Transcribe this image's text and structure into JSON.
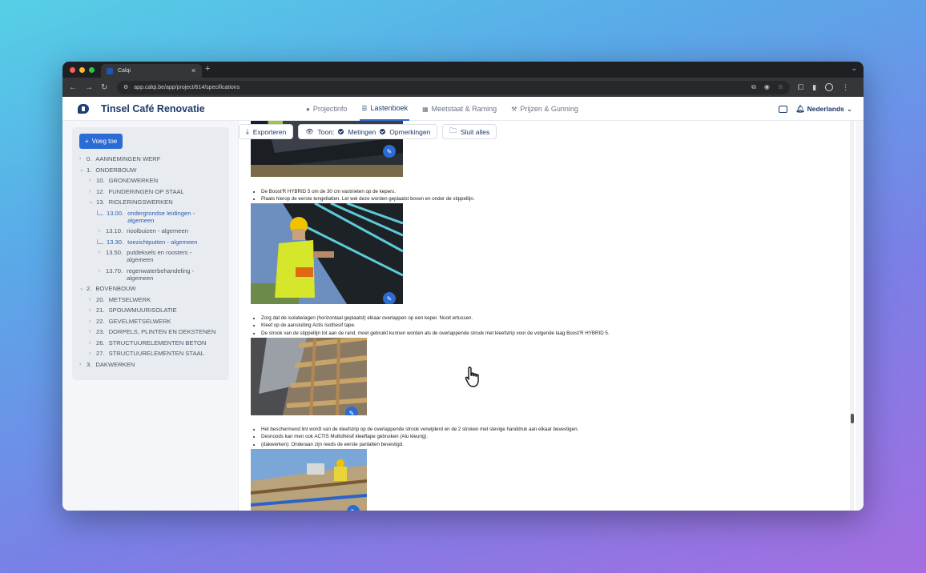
{
  "browser": {
    "tab_title": "Calqi",
    "url": "app.calqi.be/app/project/614/specifications"
  },
  "header": {
    "project_title": "Tinsel Café Renovatie",
    "nav": [
      {
        "label": "Projectinfo",
        "icon": "info-circle-icon"
      },
      {
        "label": "Lastenboek",
        "icon": "list-icon"
      },
      {
        "label": "Meetstaat & Raming",
        "icon": "grid-icon"
      },
      {
        "label": "Prijzen & Gunning",
        "icon": "gavel-icon"
      }
    ],
    "language": "Nederlands"
  },
  "sidebar": {
    "add_label": "Voeg toe",
    "items": [
      {
        "code": "0.",
        "label": "AANNEMINGEN WERF"
      },
      {
        "code": "1.",
        "label": "ONDERBOUW"
      },
      {
        "code": "10.",
        "label": "GRONDWERKEN"
      },
      {
        "code": "12.",
        "label": "FUNDERINGEN OP STAAL"
      },
      {
        "code": "13.",
        "label": "RIOLERINGSWERKEN"
      },
      {
        "code": "13.00.",
        "label": "ondergrondse leidingen - algemeen"
      },
      {
        "code": "13.10.",
        "label": "rioolbuizen - algemeen"
      },
      {
        "code": "13.30.",
        "label": "toezichtputten - algemeen"
      },
      {
        "code": "13.50.",
        "label": "putdeksels en roosters - algemeen"
      },
      {
        "code": "13.70.",
        "label": "regenwaterbehandeling - algemeen"
      },
      {
        "code": "2.",
        "label": "BOVENBOUW"
      },
      {
        "code": "20.",
        "label": "METSELWERK"
      },
      {
        "code": "21.",
        "label": "SPOUWMUURISOLATIE"
      },
      {
        "code": "22.",
        "label": "GEVELMETSELWERK"
      },
      {
        "code": "23.",
        "label": "DORPELS, PLINTEN EN DEKSTENEN"
      },
      {
        "code": "26.",
        "label": "STRUCTUURELEMENTEN BETON"
      },
      {
        "code": "27.",
        "label": "STRUCTUURELEMENTEN STAAL"
      },
      {
        "code": "3.",
        "label": "DAKWERKEN"
      }
    ]
  },
  "toolbar": {
    "export_label": "Exporteren",
    "show_label": "Toon:",
    "measurements_label": "Metingen",
    "remarks_label": "Opmerkingen",
    "close_all_label": "Sluit alles"
  },
  "content": {
    "block1": [
      "De Boost'R HYBRID 5 om de 30 cm vastnieten op de kepers.",
      "Plaats hierop de eerste tengellatten. Let wel deze worden geplaatst boven en onder de stippellijn."
    ],
    "block2": [
      "Zorg dat de isolatielagen (horizontaal geplaatst) elkaar overlappen op een keper. Nooit ertussen.",
      "Kleef op de aansluiting Actis Isothesif tape.",
      "De strook van de stippellijn tot aan de rand, moet gebruikt kunnen worden als de overlappende strook met kleefstrip voor de volgende laag Boost'R HYBRID 5."
    ],
    "block3": [
      "Het beschermend lint wordt van de kleefstrip op de overlappende strook verwijderd en de 2 stroken met stevige handdruk aan elkaar bevestigen.",
      "Desnoods kan men ook ACTIS Multidhésif kleeftape gebruiken (Alu kleurig).",
      "(dakwerken): Onderaan zijn reeds de eerste panlatten bevestigd."
    ]
  }
}
